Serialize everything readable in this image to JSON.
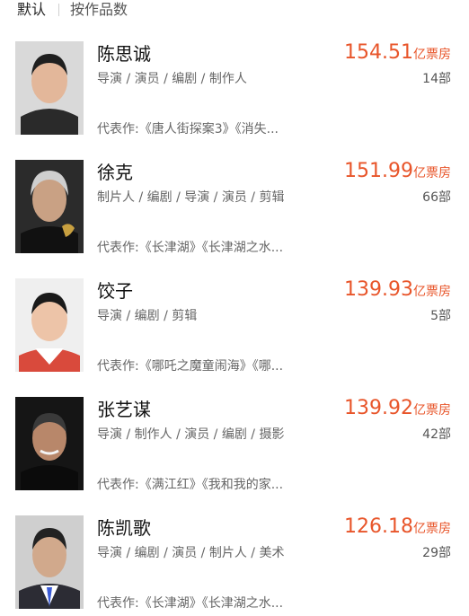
{
  "sort": {
    "default_label": "默认",
    "by_works_label": "按作品数"
  },
  "directors": [
    {
      "name": "陈思诚",
      "roles": "导演 / 演员 / 编剧 / 制作人",
      "box_value": "154.51",
      "box_unit": "亿票房",
      "count": "14部",
      "works": "代表作:《唐人街探案3》《消失..."
    },
    {
      "name": "徐克",
      "roles": "制片人 / 编剧 / 导演 / 演员 / 剪辑",
      "box_value": "151.99",
      "box_unit": "亿票房",
      "count": "66部",
      "works": "代表作:《长津湖》《长津湖之水..."
    },
    {
      "name": "饺子",
      "roles": "导演 / 编剧 / 剪辑",
      "box_value": "139.93",
      "box_unit": "亿票房",
      "count": "5部",
      "works": "代表作:《哪吒之魔童闹海》《哪..."
    },
    {
      "name": "张艺谋",
      "roles": "导演 / 制作人 / 演员 / 编剧 / 摄影",
      "box_value": "139.92",
      "box_unit": "亿票房",
      "count": "42部",
      "works": "代表作:《满江红》《我和我的家..."
    },
    {
      "name": "陈凯歌",
      "roles": "导演 / 编剧 / 演员 / 制片人 / 美术",
      "box_value": "126.18",
      "box_unit": "亿票房",
      "count": "29部",
      "works": "代表作:《长津湖》《长津湖之水..."
    }
  ],
  "colors": {
    "accent": "#e8552a",
    "secondary_text": "#666666"
  }
}
